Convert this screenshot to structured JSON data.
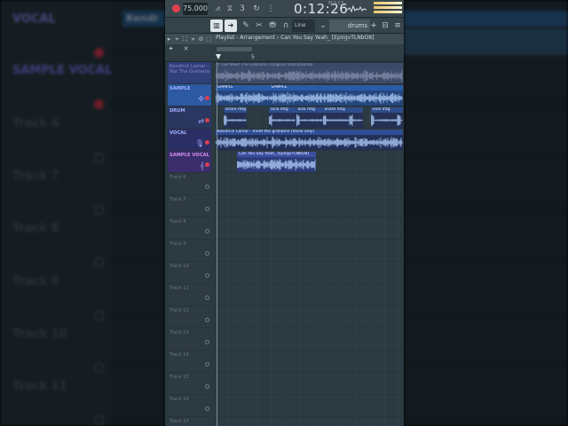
{
  "background": {
    "left_labels": [
      {
        "text": "VOCAL",
        "style": "vocal"
      },
      {
        "text": "SAMPLE VOCAL",
        "style": "sample"
      },
      {
        "text": "Track 6",
        "style": "plain"
      },
      {
        "text": "Track 7",
        "style": "plain"
      },
      {
        "text": "Track 8",
        "style": "plain"
      },
      {
        "text": "Track 9",
        "style": "plain"
      },
      {
        "text": "Track 10",
        "style": "plain"
      },
      {
        "text": "Track 11",
        "style": "plain"
      }
    ],
    "right_clip_label": "Kendr"
  },
  "toolbar": {
    "tempo": "75.000",
    "time": "0:12:26",
    "time_unit": "M:S:CS",
    "icons": [
      "record-icon",
      "metronome-icon",
      "wait-icon",
      "countdown-icon",
      "loop-record-icon"
    ]
  },
  "toolbar2": {
    "line_select": "Line",
    "channel_field": "drums",
    "plus_label": "+"
  },
  "playlist": {
    "title": "Playlist - Arrangement › Can You Say Yeah_ [EpVgvTLNbO8]",
    "ruler_marker": "5"
  },
  "tracks": [
    {
      "name": "Kendrick Lamar - Not The Grahams",
      "style": "vocal1",
      "icon": "",
      "dot": "none"
    },
    {
      "name": "SAMPLE",
      "style": "sample",
      "icon": "✣",
      "dot": "on"
    },
    {
      "name": "DRUM",
      "style": "drum",
      "icon": "⇄",
      "dot": "on"
    },
    {
      "name": "VOCAL",
      "style": "vocal",
      "icon": "🎙",
      "dot": "on"
    },
    {
      "name": "SAMPLE VOCAL",
      "style": "svocal",
      "icon": "𝄞",
      "dot": "on"
    },
    {
      "name": "Track 6",
      "style": "plain",
      "icon": "",
      "dot": "off"
    },
    {
      "name": "Track 7",
      "style": "plain",
      "icon": "",
      "dot": "off"
    },
    {
      "name": "Track 8",
      "style": "plain",
      "icon": "",
      "dot": "off"
    },
    {
      "name": "Track 9",
      "style": "plain",
      "icon": "",
      "dot": "off"
    },
    {
      "name": "Track 10",
      "style": "plain",
      "icon": "",
      "dot": "off"
    },
    {
      "name": "Track 11",
      "style": "plain",
      "icon": "",
      "dot": "off"
    },
    {
      "name": "Track 12",
      "style": "plain",
      "icon": "",
      "dot": "off"
    },
    {
      "name": "Track 13",
      "style": "plain",
      "icon": "",
      "dot": "off"
    },
    {
      "name": "Track 14",
      "style": "plain",
      "icon": "",
      "dot": "off"
    },
    {
      "name": "Track 15",
      "style": "plain",
      "icon": "",
      "dot": "off"
    },
    {
      "name": "Track 16",
      "style": "plain",
      "icon": "",
      "dot": "off"
    },
    {
      "name": "Track 17",
      "style": "plain",
      "icon": "",
      "dot": "off"
    }
  ],
  "clips": [
    {
      "label": "Y Out Meet The Grahams (Original Instrumental",
      "style": "c-instr",
      "track": 0,
      "start": 0,
      "end": 14
    },
    {
      "label": "SAMPLE",
      "style": "c-sample",
      "track": 1,
      "start": 0,
      "end": 4
    },
    {
      "label": "SAMPLE",
      "style": "c-sample",
      "track": 1,
      "start": 4,
      "end": 14
    },
    {
      "label": "snare mtg",
      "style": "c-drum",
      "track": 2,
      "start": 0.6,
      "end": 2.3
    },
    {
      "label": "kick mtg",
      "style": "c-drum",
      "track": 2,
      "start": 4,
      "end": 6
    },
    {
      "label": "kick mtg",
      "style": "c-drum",
      "track": 2,
      "start": 6,
      "end": 8
    },
    {
      "label": "snare mtg",
      "style": "c-drum",
      "track": 2,
      "start": 8,
      "end": 11
    },
    {
      "label": "kick mtg",
      "style": "c-drum",
      "track": 2,
      "start": 11.6,
      "end": 14
    },
    {
      "label": "Kendrick Lamar - meet the grahams (Vocal only)",
      "style": "c-vocal",
      "track": 3,
      "start": 0,
      "end": 14
    },
    {
      "label": "Can You Say Yeah_ [EpVgvTLNbO8]",
      "style": "c-svocal",
      "track": 4,
      "start": 1.6,
      "end": 7.5
    }
  ]
}
